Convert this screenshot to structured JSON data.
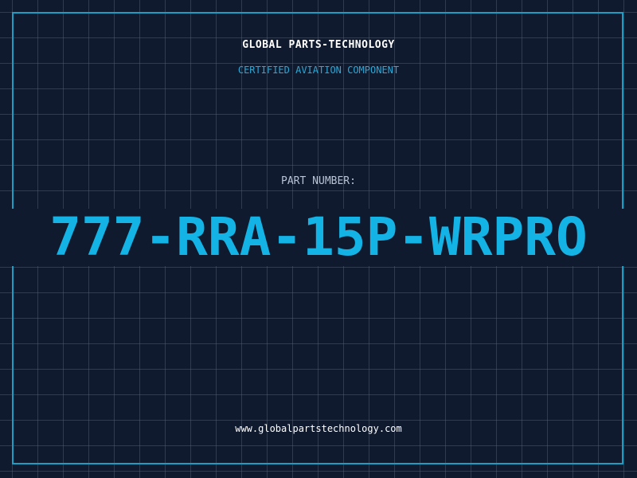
{
  "header": {
    "company": "GLOBAL PARTS-TECHNOLOGY",
    "subtitle": "CERTIFIED AVIATION COMPONENT"
  },
  "part": {
    "label": "PART NUMBER:",
    "number": "777-RRA-15P-WRPRO"
  },
  "footer": {
    "url": "www.globalpartstechnology.com"
  },
  "colors": {
    "background": "#0f1a2e",
    "grid": "#28788f",
    "accent": "#13b3e6",
    "frame": "#1a9ec4"
  }
}
